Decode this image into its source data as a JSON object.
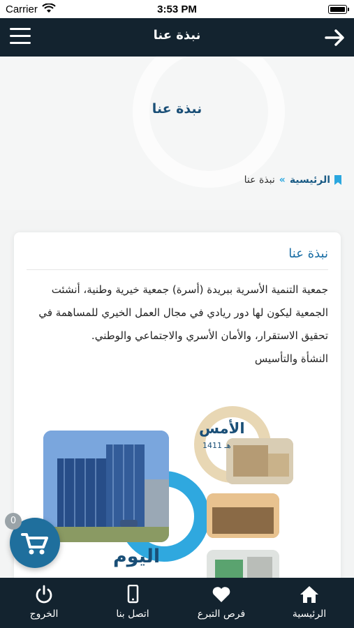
{
  "status_bar": {
    "carrier": "Carrier",
    "time": "3:53 PM"
  },
  "header": {
    "title": "نبذة عنا"
  },
  "hero": {
    "title": "نبذة عنا"
  },
  "breadcrumb": {
    "home": "الرئيسية",
    "separator": "»",
    "current": "نبذة عنا"
  },
  "card": {
    "title": "نبذة عنا",
    "paragraphs": [
      "جمعية التنمية الأسرية ببريدة (أسرة) جمعية خيرية وطنية، أنشئت الجمعية ليكون لها دور ريادي في مجال العمل الخيري للمساهمة في تحقيق الاستقرار، والأمان الأسري والاجتماعي والوطني.",
      "النشأة والتأسيس"
    ]
  },
  "infographic": {
    "past_label": "الأمس",
    "past_year": "1411 هـ",
    "today_label": "اليوم"
  },
  "cart": {
    "count": "0"
  },
  "tabs": [
    {
      "label": "الرئيسية",
      "icon": "home-icon"
    },
    {
      "label": "فرص التبرع",
      "icon": "heart-icon"
    },
    {
      "label": "اتصل بنا",
      "icon": "phone-icon"
    },
    {
      "label": "الخروج",
      "icon": "power-icon"
    }
  ],
  "colors": {
    "header": "#13232f",
    "accent": "#2aa7df",
    "title": "#1a4f77",
    "fab": "#1f6f9d"
  }
}
